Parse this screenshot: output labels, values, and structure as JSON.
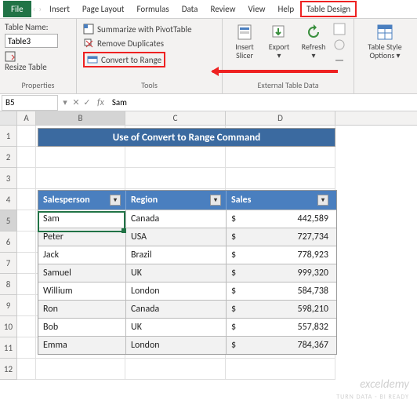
{
  "tabs": {
    "file": "File",
    "insert": "Insert",
    "page_layout": "Page Layout",
    "formulas": "Formulas",
    "data": "Data",
    "review": "Review",
    "view": "View",
    "help": "Help",
    "table_design": "Table Design"
  },
  "ribbon": {
    "properties": {
      "label": "Properties",
      "table_name_label": "Table Name:",
      "table_name_value": "Table3",
      "resize": "Resize Table"
    },
    "tools": {
      "label": "Tools",
      "summarize": "Summarize with PivotTable",
      "remove_dup": "Remove Duplicates",
      "convert": "Convert to Range"
    },
    "external": {
      "label": "External Table Data",
      "insert_slicer": "Insert Slicer",
      "export": "Export",
      "refresh": "Refresh"
    },
    "style_opts": {
      "label": "Table Style Options"
    }
  },
  "formula_bar": {
    "name_box": "B5",
    "fx": "fx",
    "value": "Sam"
  },
  "columns": {
    "A": "A",
    "B": "B",
    "C": "C",
    "D": "D"
  },
  "row_nums": [
    "1",
    "2",
    "3",
    "4",
    "5",
    "6",
    "7",
    "8",
    "9",
    "10",
    "11",
    "12"
  ],
  "title": "Use of Convert to Range Command",
  "table": {
    "headers": {
      "salesperson": "Salesperson",
      "region": "Region",
      "sales": "Sales"
    },
    "rows": [
      {
        "sp": "Sam",
        "rg": "Canada",
        "cur": "$",
        "val": "442,589"
      },
      {
        "sp": "Peter",
        "rg": "USA",
        "cur": "$",
        "val": "727,734"
      },
      {
        "sp": "Jack",
        "rg": "Brazil",
        "cur": "$",
        "val": "778,923"
      },
      {
        "sp": "Samuel",
        "rg": "UK",
        "cur": "$",
        "val": "999,320"
      },
      {
        "sp": "Willium",
        "rg": "London",
        "cur": "$",
        "val": "584,738"
      },
      {
        "sp": "Ron",
        "rg": "Canada",
        "cur": "$",
        "val": "598,210"
      },
      {
        "sp": "Bob",
        "rg": "UK",
        "cur": "$",
        "val": "557,832"
      },
      {
        "sp": "Emma",
        "rg": "London",
        "cur": "$",
        "val": "784,367"
      }
    ]
  },
  "watermark": {
    "main": "exceldemy",
    "sub": "TURN DATA - BI READY"
  },
  "chart_data": {
    "type": "table",
    "title": "Use of Convert to Range Command",
    "columns": [
      "Salesperson",
      "Region",
      "Sales"
    ],
    "rows": [
      [
        "Sam",
        "Canada",
        442589
      ],
      [
        "Peter",
        "USA",
        727734
      ],
      [
        "Jack",
        "Brazil",
        778923
      ],
      [
        "Samuel",
        "UK",
        999320
      ],
      [
        "Willium",
        "London",
        584738
      ],
      [
        "Ron",
        "Canada",
        598210
      ],
      [
        "Bob",
        "UK",
        557832
      ],
      [
        "Emma",
        "London",
        784367
      ]
    ]
  }
}
